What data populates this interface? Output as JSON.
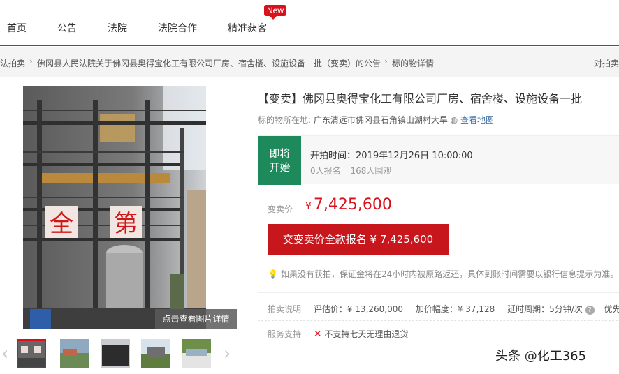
{
  "nav": {
    "items": [
      "首页",
      "公告",
      "法院",
      "法院合作",
      "精准获客"
    ],
    "new_badge": "New"
  },
  "breadcrumb": {
    "items": [
      "法拍卖",
      "佛冈县人民法院关于佛冈县奥得宝化工有限公司厂房、宿舍楼、设施设备一批（变卖）的公告",
      "标的物详情"
    ],
    "right_text": "对拍卖"
  },
  "gallery": {
    "banner_chars": [
      "全",
      "第"
    ],
    "view_details_label": "点击查看图片详情",
    "prev_arrow": "‹",
    "next_arrow": "›"
  },
  "listing": {
    "title": "【变卖】佛冈县奥得宝化工有限公司厂房、宿舍楼、设施设备一批",
    "location_label": "标的物所在地:",
    "location_value": "广东清远市佛冈县石角镇山湖村大旱",
    "map_link": "查看地图"
  },
  "auction": {
    "status_line1": "即将",
    "status_line2": "开始",
    "start_time": "开拍时间：2019年12月26日 10:00:00",
    "signups": "0人报名",
    "watchers": "168人围观",
    "price_label": "变卖价",
    "price_symbol": "¥",
    "price_value": "7,425,600",
    "register_button": "交变卖价全款报名 ¥ 7,425,600",
    "tip_text": "如果没有获拍，保证金将在24小时内被原路返还，具体到账时间需要以银行信息提示为准。"
  },
  "rules": {
    "label": "拍卖说明",
    "appraisal": "评估价：¥ 13,260,000",
    "increment": "加价幅度：¥ 37,128",
    "delay": "延时周期：5分钟/次",
    "priority": "优先竞"
  },
  "service": {
    "label": "服务支持",
    "no_return": "不支持七天无理由退货"
  },
  "watermark": "头条 @化工365",
  "colors": {
    "accent_red": "#d9111b",
    "status_green": "#1e8a5c",
    "link_blue": "#3b6ea5"
  }
}
